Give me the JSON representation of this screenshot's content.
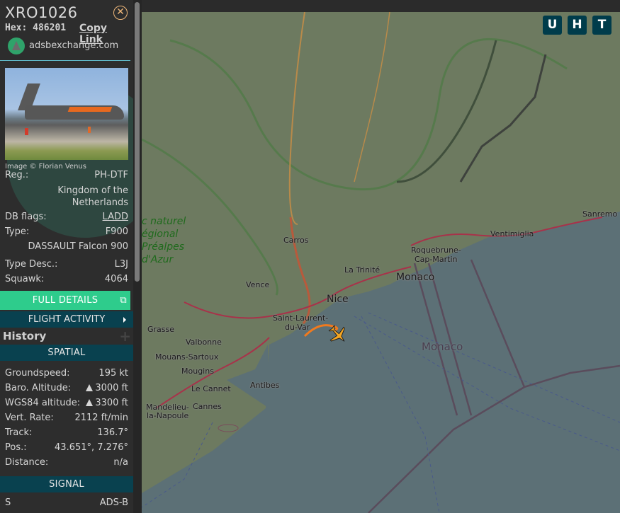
{
  "aircraft": {
    "callsign": "XRO1026",
    "hex_label": "Hex:",
    "hex": "486201",
    "copy_link": "Copy Link",
    "source_site": "adsbexchange.com",
    "image_credit": "Image © Florian Venus"
  },
  "details": {
    "reg_label": "Reg.:",
    "reg": "PH-DTF",
    "country": "Kingdom of the Netherlands",
    "dbflags_label": "DB flags:",
    "dbflags": "LADD",
    "type_label": "Type:",
    "type": "F900",
    "type_full": "DASSAULT Falcon 900",
    "typedesc_label": "Type Desc.:",
    "typedesc": "L3J",
    "squawk_label": "Squawk:",
    "squawk": "4064"
  },
  "buttons": {
    "full_details": "FULL DETAILS",
    "flight_activity": "FLIGHT ACTIVITY"
  },
  "history": {
    "title": "History",
    "plus": "+"
  },
  "spatial": {
    "header": "SPATIAL",
    "rows": [
      {
        "label": "Groundspeed:",
        "value": "195 kt"
      },
      {
        "label": "Baro. Altitude:",
        "value": "3000 ft",
        "trend": "up"
      },
      {
        "label": "WGS84 altitude:",
        "value": "3300 ft",
        "trend": "up"
      },
      {
        "label": "Vert. Rate:",
        "value": "2112 ft/min"
      },
      {
        "label": "Track:",
        "value": "136.7°"
      },
      {
        "label": "Pos.:",
        "value": "43.651°, 7.276°"
      },
      {
        "label": "Distance:",
        "value": "n/a"
      }
    ]
  },
  "signal": {
    "header": "SIGNAL",
    "partial_label": "S",
    "partial_value": "ADS-B"
  },
  "map": {
    "buttons": [
      "U",
      "H",
      "T"
    ],
    "labels": {
      "park": [
        "c naturel",
        "égional",
        " Préalpes",
        "d'Azur"
      ],
      "carros": "Carros",
      "vence": "Vence",
      "la_trinite": "La Trinité",
      "nice": "Nice",
      "monaco": "Monaco",
      "monaco_sea": "Monaco",
      "roquebrune": "Roquebrune-",
      "cap_martin": "Cap-Martin",
      "ventimiglia": "Ventimiglia",
      "sanremo": "Sanremo",
      "saint_laurent": "Saint-Laurent-",
      "du_var": "du-Var",
      "grasse": "Grasse",
      "valbonne": "Valbonne",
      "mouans": "Mouans-Sartoux",
      "mougins": "Mougins",
      "le_cannet": "Le Cannet",
      "antibes": "Antibes",
      "cannes": "Cannes",
      "mandelieu": "Mandelieu-",
      "la_napoule": "la-Napoule"
    },
    "colors": {
      "sea": "#5c7076",
      "land": "#6e7b62",
      "track": "#f07a1e",
      "aircraft": "#f5a623"
    }
  }
}
